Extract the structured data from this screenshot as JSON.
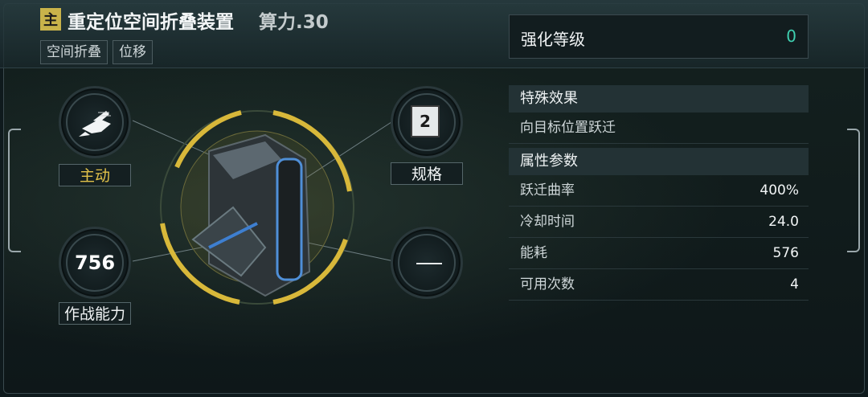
{
  "header": {
    "badge": "主",
    "title": "重定位空间折叠装置",
    "compute": "算力.30",
    "tags": [
      "空间折叠",
      "位移"
    ]
  },
  "left": {
    "type_label": "主动",
    "combat_value": "756",
    "combat_label": "作战能力"
  },
  "right": {
    "spec_value": "2",
    "spec_label": "规格"
  },
  "enhance": {
    "label": "强化等级",
    "value": "0"
  },
  "special": {
    "heading": "特殊效果",
    "text": "向目标位置跃迁"
  },
  "attributes": {
    "heading": "属性参数",
    "rows": [
      {
        "name": "跃迁曲率",
        "value": "400%"
      },
      {
        "name": "冷却时间",
        "value": "24.0"
      },
      {
        "name": "能耗",
        "value": "576"
      },
      {
        "name": "可用次数",
        "value": "4"
      }
    ]
  },
  "colors": {
    "gold": "#e2c24a",
    "teal": "#3fd0b0",
    "panel": "#233235"
  }
}
